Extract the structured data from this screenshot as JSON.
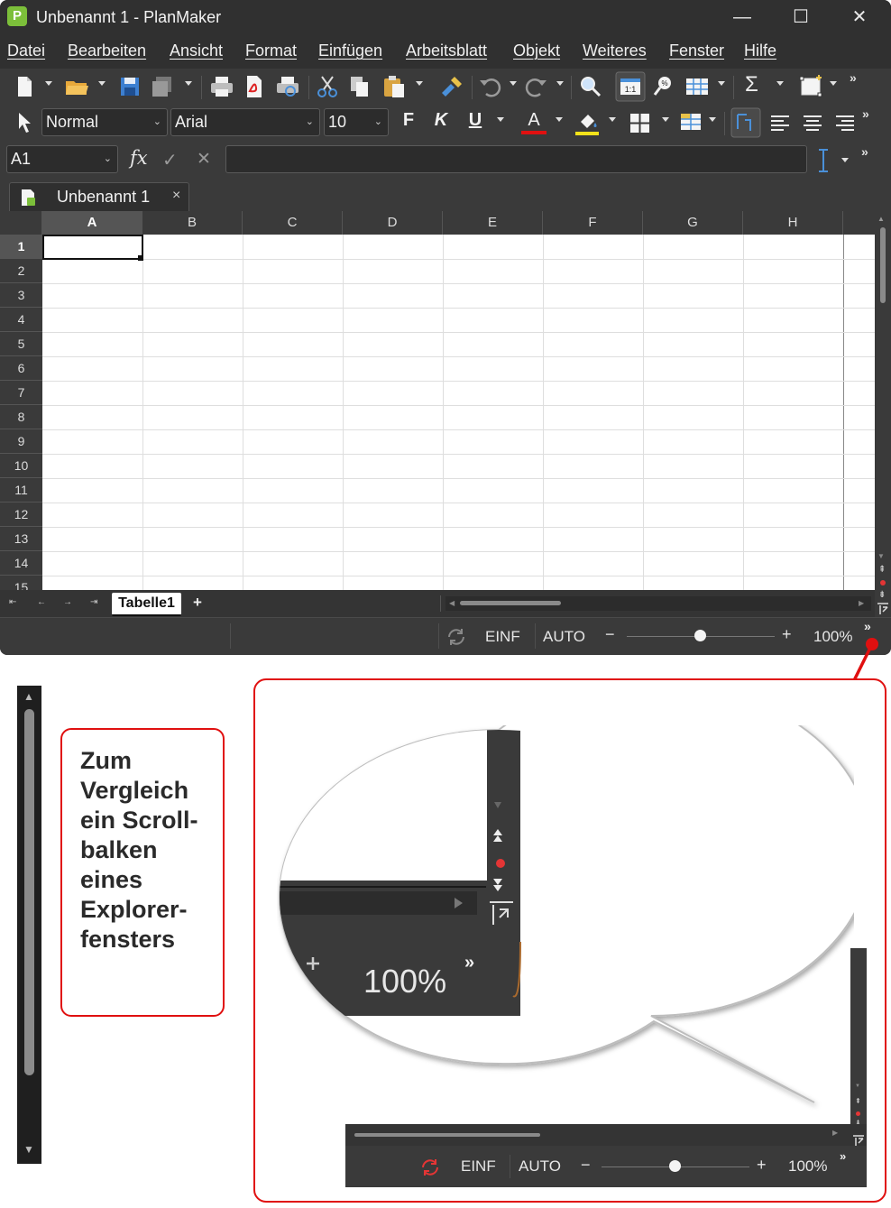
{
  "window": {
    "title": "Unbenannt 1 - PlanMaker",
    "app_icon": "P",
    "minimize": "—",
    "maximize": "☐",
    "close": "✕"
  },
  "menu": [
    "Datei",
    "Bearbeiten",
    "Ansicht",
    "Format",
    "Einfügen",
    "Arbeitsblatt",
    "Objekt",
    "Weiteres",
    "Fenster",
    "Hilfe"
  ],
  "format_toolbar": {
    "style": "Normal",
    "font": "Arial",
    "size": "10",
    "bold": "F",
    "italic": "K",
    "underline": "U",
    "font_color_letter": "A"
  },
  "formula_bar": {
    "cell_ref": "A1",
    "fx": "fx",
    "confirm": "✓",
    "cancel": "✕",
    "content": ""
  },
  "document_tab": {
    "label": "Unbenannt 1",
    "close": "×"
  },
  "grid": {
    "columns": [
      "A",
      "B",
      "C",
      "D",
      "E",
      "F",
      "G",
      "H"
    ],
    "rows": [
      "1",
      "2",
      "3",
      "4",
      "5",
      "6",
      "7",
      "8",
      "9",
      "10",
      "11",
      "12",
      "13",
      "14",
      "15"
    ],
    "active_cell": "A1"
  },
  "sheet_tabs": {
    "active": "Tabelle1",
    "add": "+"
  },
  "status": {
    "mode_insert": "EINF",
    "mode_calc": "AUTO",
    "zoom": "100%",
    "minus": "−",
    "plus": "+",
    "more": "»"
  },
  "annotation": {
    "note_text": "Zum Vergleich ein Scroll-balken eines Explorer-fensters",
    "zoom_bubble_value": "100%",
    "zoom_bubble_more": "»"
  },
  "lower_statusbar": {
    "mode_insert": "EINF",
    "mode_calc": "AUTO",
    "zoom": "100%",
    "minus": "−",
    "plus": "+",
    "more": "»"
  },
  "colors": {
    "window_bg": "#3a3a3a",
    "titlebar_bg": "#303030",
    "accent_red": "#e01010",
    "app_green": "#7cbf3a",
    "icon_blue": "#4a90d9"
  }
}
